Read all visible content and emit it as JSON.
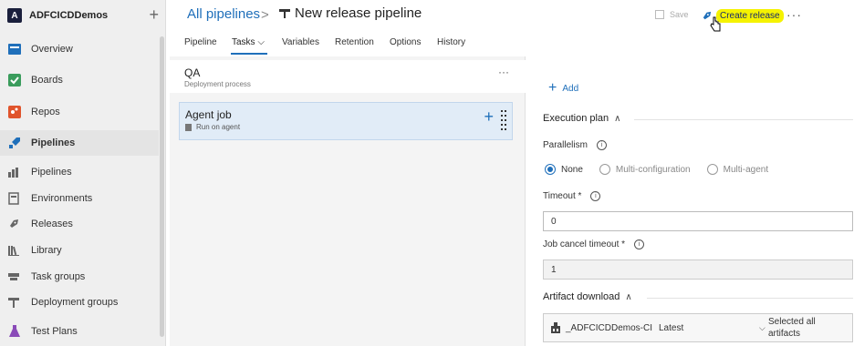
{
  "sidebar": {
    "org_initial": "A",
    "org_name": "ADFCICDDemos",
    "org_add": "+",
    "items": [
      {
        "label": "Overview"
      },
      {
        "label": "Boards"
      },
      {
        "label": "Repos"
      },
      {
        "label": "Pipelines"
      },
      {
        "label": "Pipelines"
      },
      {
        "label": "Environments"
      },
      {
        "label": "Releases"
      },
      {
        "label": "Library"
      },
      {
        "label": "Task groups"
      },
      {
        "label": "Deployment groups"
      },
      {
        "label": "Test Plans"
      }
    ]
  },
  "header": {
    "breadcrumb": "All pipelines",
    "separator": ">",
    "title": "New release pipeline",
    "save_label": "Save",
    "create_label": "Create release",
    "more": "···"
  },
  "tabs": [
    {
      "label": "Pipeline"
    },
    {
      "label": "Tasks ⌵"
    },
    {
      "label": "Variables"
    },
    {
      "label": "Retention"
    },
    {
      "label": "Options"
    },
    {
      "label": "History"
    }
  ],
  "stage": {
    "name": "QA",
    "subtitle": "Deployment process",
    "more": "···"
  },
  "job": {
    "name": "Agent job",
    "subtitle": "Run on agent",
    "add": "+"
  },
  "props": {
    "add_label": "Add",
    "execution_plan": "Execution plan",
    "parallelism_label": "Parallelism",
    "parallelism_options": [
      "None",
      "Multi-configuration",
      "Multi-agent"
    ],
    "parallelism_selected": "None",
    "timeout_label": "Timeout *",
    "timeout_value": "0",
    "job_cancel_label": "Job cancel timeout *",
    "job_cancel_value": "1",
    "artifact_download": "Artifact download",
    "artifact_name": "_ADFCICDDemos-CI",
    "artifact_version": "Latest",
    "artifact_selection": "Selected all artifacts",
    "info_glyph": "i",
    "chevron_up": "∧"
  },
  "colors": {
    "accent": "#1f6fba",
    "highlight": "#f5f200",
    "job_bg": "#e1ecf7"
  }
}
